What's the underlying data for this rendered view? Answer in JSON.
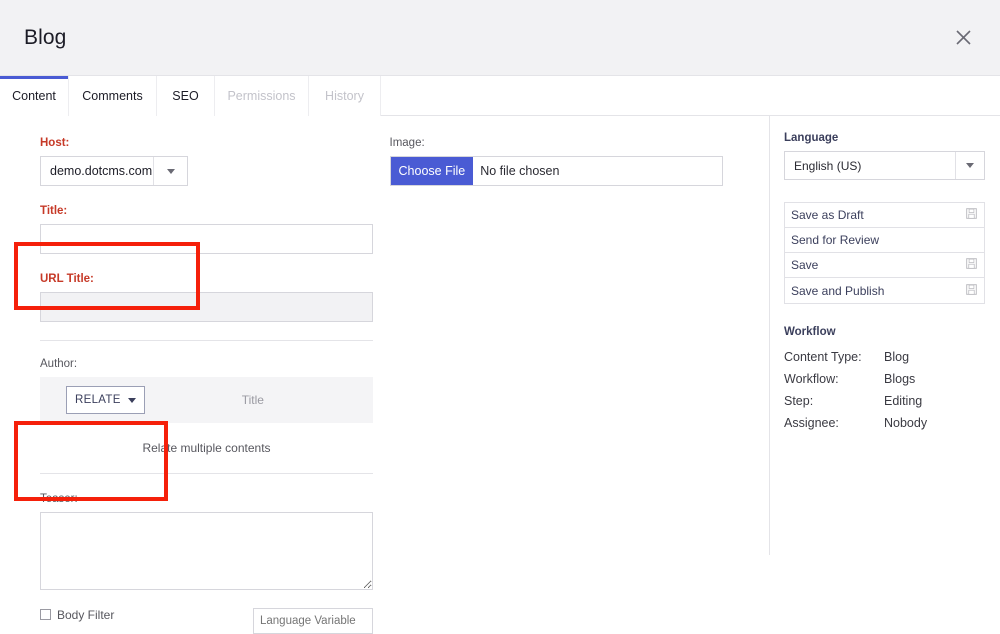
{
  "header": {
    "title": "Blog",
    "close_icon": "close-icon"
  },
  "tabs": [
    {
      "label": "Content",
      "active": true,
      "disabled": false
    },
    {
      "label": "Comments",
      "active": false,
      "disabled": false
    },
    {
      "label": "SEO",
      "active": false,
      "disabled": false
    },
    {
      "label": "Permissions",
      "active": false,
      "disabled": true
    },
    {
      "label": "History",
      "active": false,
      "disabled": true
    }
  ],
  "form": {
    "host": {
      "label": "Host:",
      "value": "demo.dotcms.com",
      "arrow_icon": "chevron-down-icon"
    },
    "title": {
      "label": "Title:",
      "value": "",
      "placeholder": ""
    },
    "url_title": {
      "label": "URL Title:",
      "value": "",
      "placeholder": ""
    },
    "author": {
      "label": "Author:",
      "relate_button": "RELATE",
      "relate_arrow_icon": "chevron-down-icon",
      "column_title": "Title",
      "hint": "Relate multiple contents"
    },
    "teaser": {
      "label": "Teaser:",
      "value": "",
      "placeholder": ""
    },
    "image": {
      "label": "Image:",
      "choose_file_label": "Choose File",
      "file_status": "No file chosen"
    },
    "cut_off": {
      "checkbox_label": "Body Filter",
      "input_placeholder": "Language Variable"
    }
  },
  "sidebar": {
    "language": {
      "heading": "Language",
      "value": "English (US)",
      "arrow_icon": "chevron-down-icon"
    },
    "actions": [
      {
        "label": "Save as Draft",
        "icon": "save-icon",
        "has_icon": true
      },
      {
        "label": "Send for Review",
        "icon": "",
        "has_icon": false
      },
      {
        "label": "Save",
        "icon": "save-icon",
        "has_icon": true
      },
      {
        "label": "Save and Publish",
        "icon": "save-icon",
        "has_icon": true
      }
    ],
    "workflow": {
      "heading": "Workflow",
      "rows": [
        {
          "key": "Content Type:",
          "value": "Blog"
        },
        {
          "key": "Workflow:",
          "value": "Blogs"
        },
        {
          "key": "Step:",
          "value": "Editing"
        },
        {
          "key": "Assignee:",
          "value": "Nobody"
        }
      ]
    }
  },
  "annotations": {
    "color": "#f5200a",
    "boxes": [
      {
        "name": "host-field-highlight",
        "target": "Host field"
      },
      {
        "name": "author-field-highlight",
        "target": "Author relate field"
      }
    ]
  },
  "colors": {
    "accent_blue": "#4a5bd4",
    "required_red": "#c63927",
    "annotation_red": "#f5200a",
    "header_bg": "#f2f2f4"
  }
}
